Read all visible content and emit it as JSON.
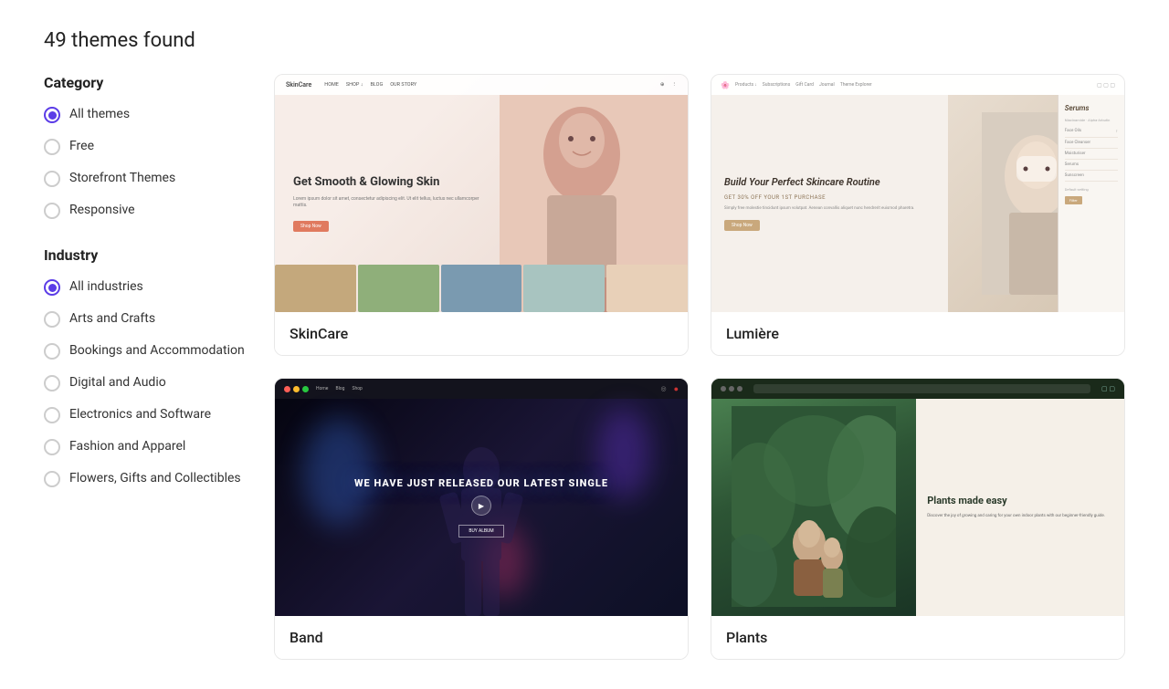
{
  "page": {
    "results_count": "49 themes found"
  },
  "sidebar": {
    "category": {
      "title": "Category",
      "items": [
        {
          "id": "all-themes",
          "label": "All themes",
          "active": true
        },
        {
          "id": "free",
          "label": "Free",
          "active": false
        },
        {
          "id": "storefront-themes",
          "label": "Storefront Themes",
          "active": false
        },
        {
          "id": "responsive",
          "label": "Responsive",
          "active": false
        }
      ]
    },
    "industry": {
      "title": "Industry",
      "items": [
        {
          "id": "all-industries",
          "label": "All industries",
          "active": true
        },
        {
          "id": "arts-crafts",
          "label": "Arts and Crafts",
          "active": false
        },
        {
          "id": "bookings",
          "label": "Bookings and Accommodation",
          "active": false
        },
        {
          "id": "digital-audio",
          "label": "Digital and Audio",
          "active": false
        },
        {
          "id": "electronics",
          "label": "Electronics and Software",
          "active": false
        },
        {
          "id": "fashion",
          "label": "Fashion and Apparel",
          "active": false
        },
        {
          "id": "flowers",
          "label": "Flowers, Gifts and Collectibles",
          "active": false
        }
      ]
    }
  },
  "themes": [
    {
      "id": "skincare",
      "name": "SkinCare",
      "hero_headline": "Get Smooth & Glowing Skin",
      "hero_sub": "Lorem ipsum dolor sit amet, consectetur adipiscing elit.",
      "cta": "Shop Now"
    },
    {
      "id": "lumiere",
      "name": "Lumière",
      "hero_headline": "Build Your Perfect Skincare Routine",
      "hero_discount": "GET 30% OFF YOUR 1ST PURCHASE",
      "panel_title": "Serums"
    },
    {
      "id": "band",
      "name": "Band",
      "hero_headline": "WE HAVE JUST RELEASED OUR LATEST SINGLE",
      "cta": "BUY ALBUM"
    },
    {
      "id": "plants",
      "name": "Plants",
      "hero_headline": "Plants made easy"
    }
  ]
}
